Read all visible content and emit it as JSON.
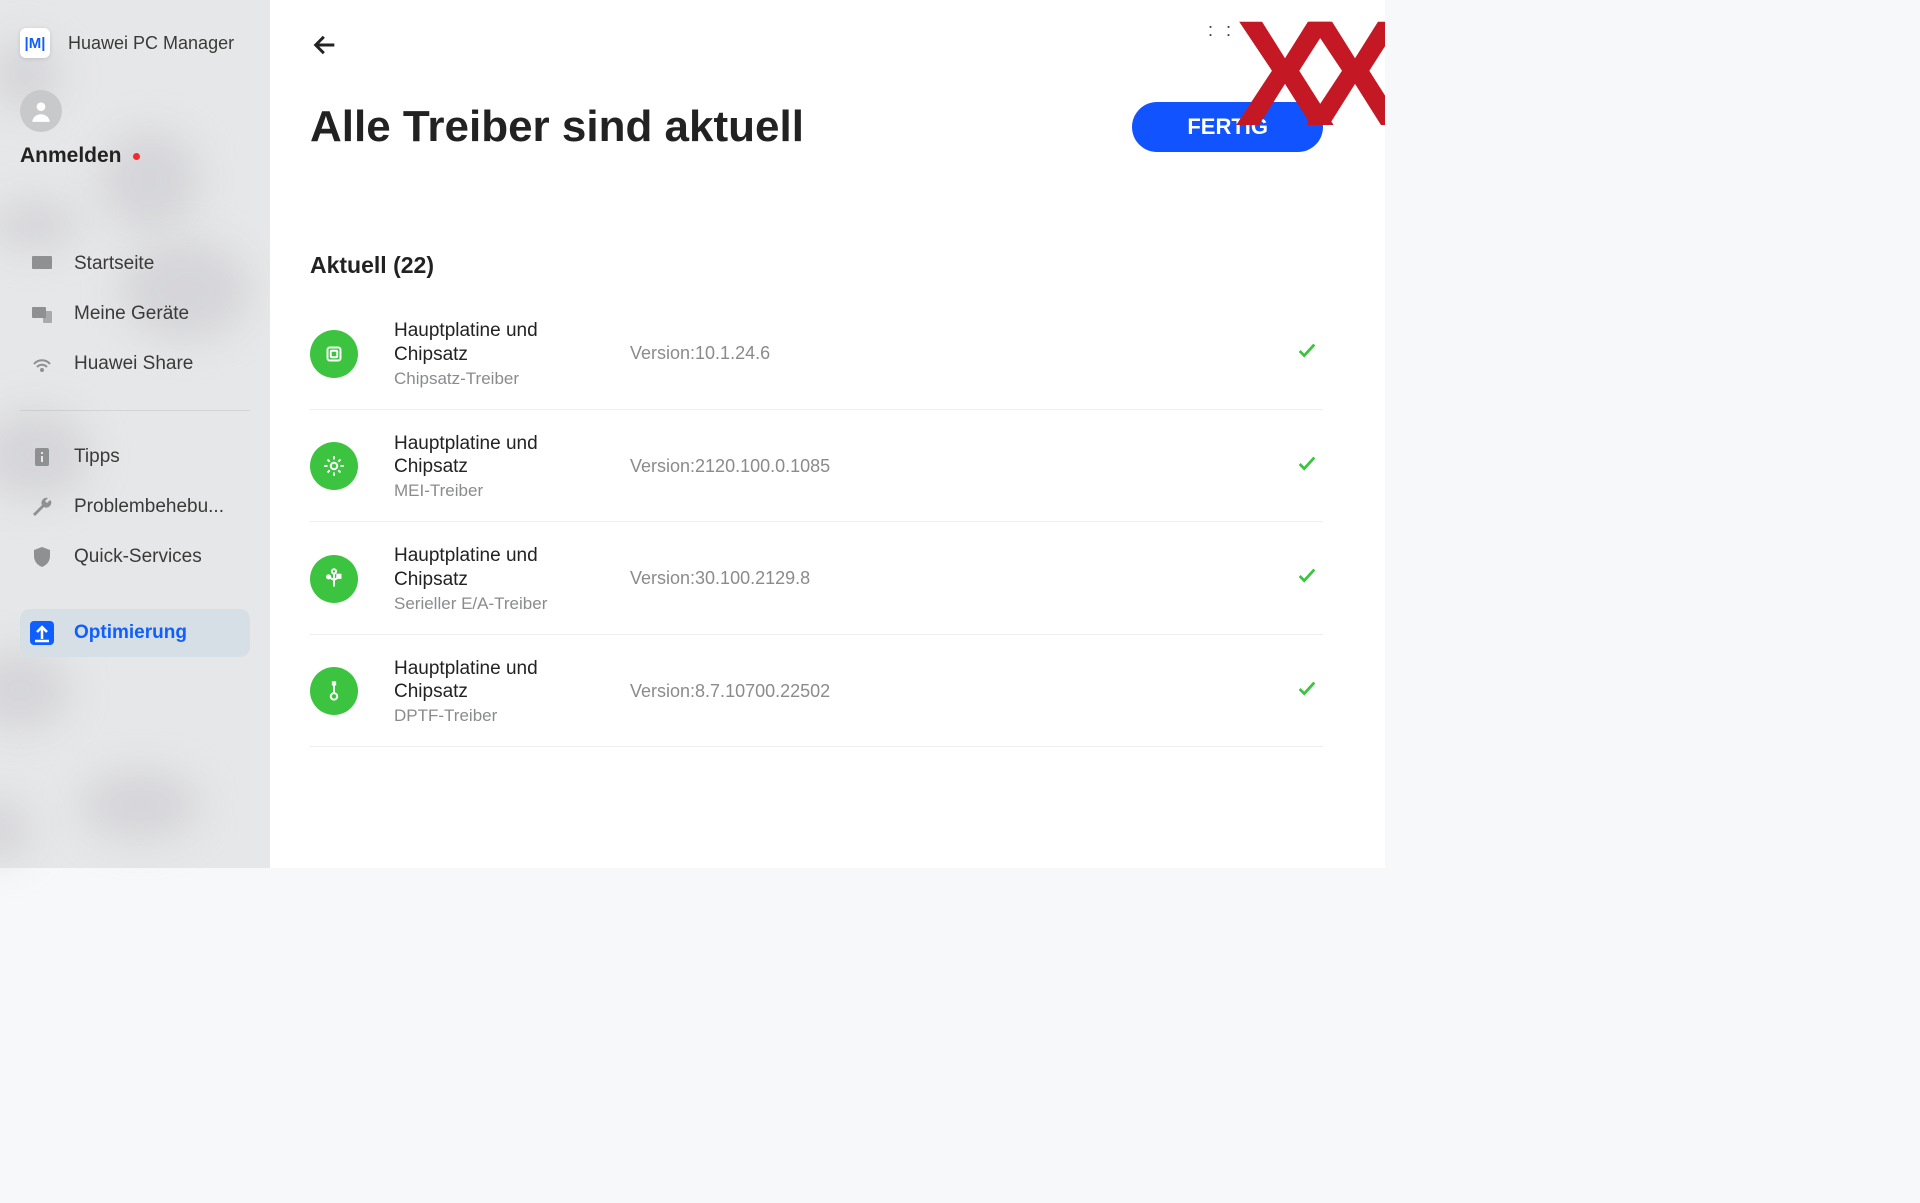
{
  "app_name": "Huawei PC Manager",
  "brand_icon_text": "|M|",
  "user": {
    "login_label": "Anmelden"
  },
  "nav": {
    "group1": [
      {
        "label": "Startseite"
      },
      {
        "label": "Meine Geräte"
      },
      {
        "label": "Huawei Share"
      }
    ],
    "group2": [
      {
        "label": "Tipps"
      },
      {
        "label": "Problembehebu..."
      },
      {
        "label": "Quick-Services"
      }
    ],
    "active": {
      "label": "Optimierung"
    }
  },
  "page": {
    "headline": "Alle Treiber sind aktuell",
    "done_label": "FERTIG",
    "section_title": "Aktuell (22)",
    "version_prefix": "Version:"
  },
  "drivers": [
    {
      "title": "Hauptplatine und Chipsatz",
      "sub": "Chipsatz-Treiber",
      "version": "10.1.24.6",
      "icon": "chip"
    },
    {
      "title": "Hauptplatine und Chipsatz",
      "sub": "MEI-Treiber",
      "version": "2120.100.0.1085",
      "icon": "gear"
    },
    {
      "title": "Hauptplatine und Chipsatz",
      "sub": "Serieller E/A-Treiber",
      "version": "30.100.2129.8",
      "icon": "usb"
    },
    {
      "title": "Hauptplatine und Chipsatz",
      "sub": "DPTF-Treiber",
      "version": "8.7.10700.22502",
      "icon": "therm"
    }
  ],
  "watermark": "XX"
}
